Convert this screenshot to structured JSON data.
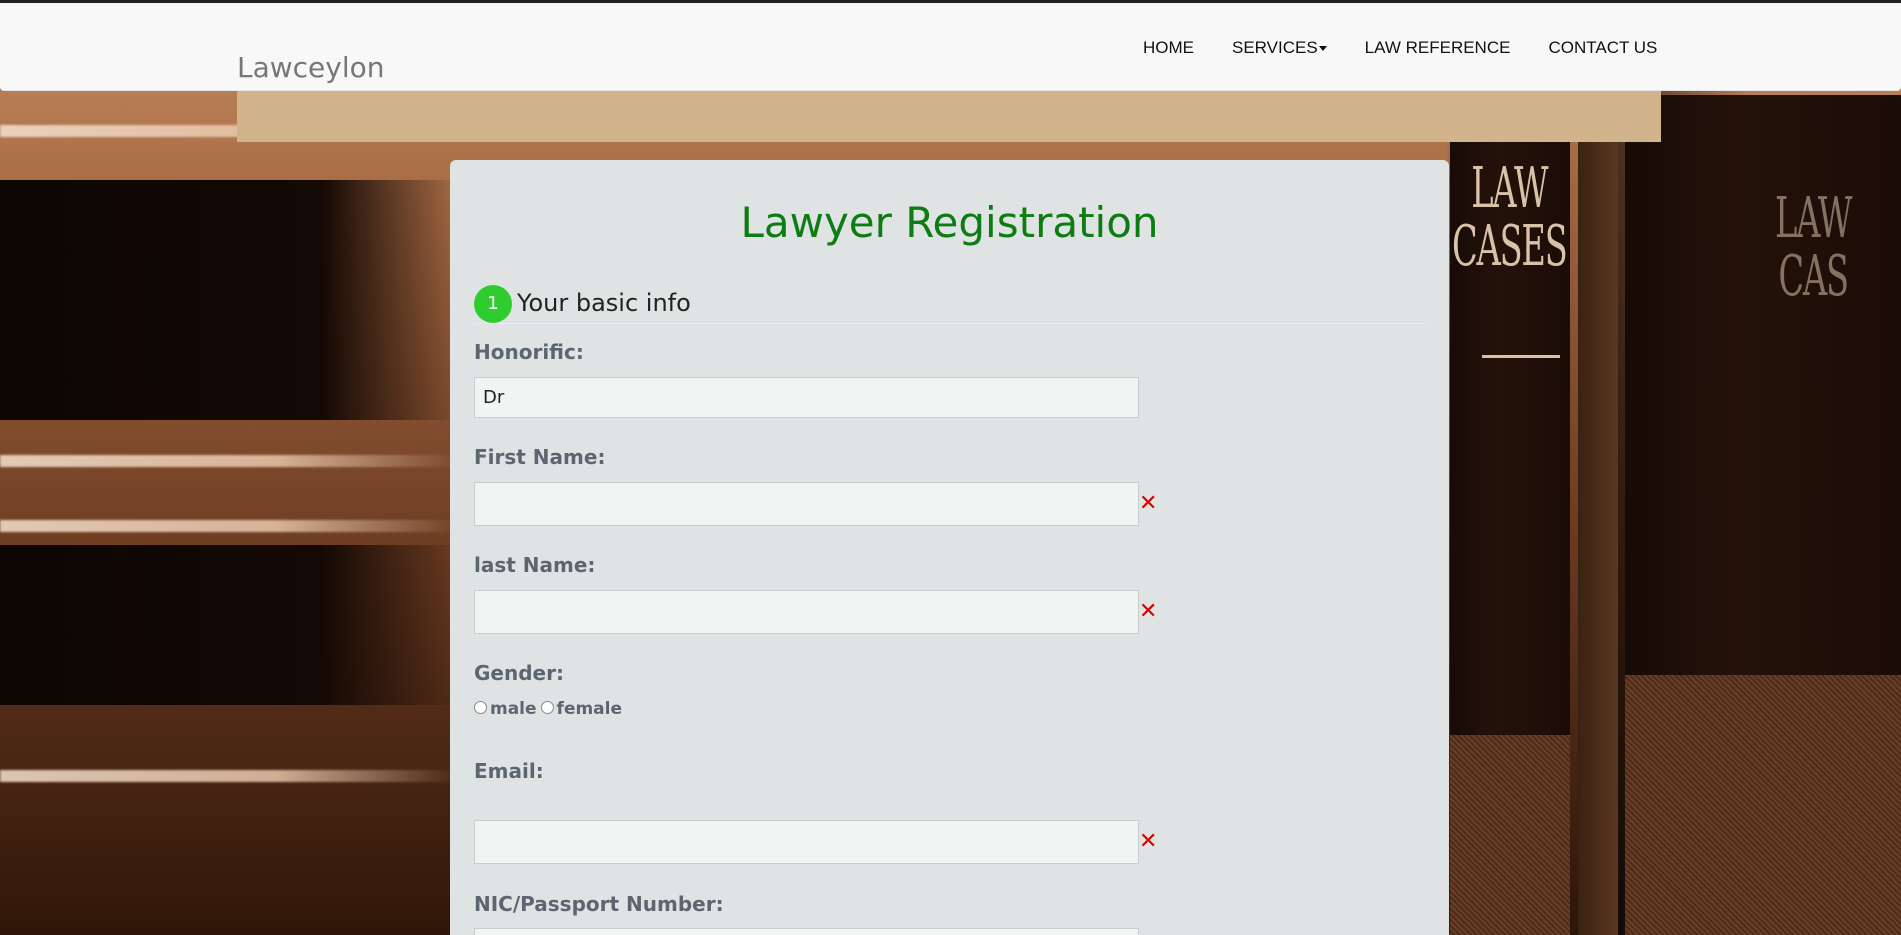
{
  "navbar": {
    "brand": "Lawceylon",
    "items": [
      {
        "label": "HOME"
      },
      {
        "label": "SERVICES",
        "has_dropdown": true
      },
      {
        "label": "LAW REFERENCE"
      },
      {
        "label": "CONTACT US"
      }
    ]
  },
  "form": {
    "title": "Lawyer Registration",
    "section": {
      "step": "1",
      "title": "Your basic info"
    },
    "honorific": {
      "label": "Honorific:",
      "value": "Dr"
    },
    "first_name": {
      "label": "First Name:",
      "value": ""
    },
    "last_name": {
      "label": "last Name:",
      "value": ""
    },
    "gender": {
      "label": "Gender:",
      "options": [
        "male",
        "female"
      ]
    },
    "email": {
      "label": "Email:",
      "value": ""
    },
    "nic": {
      "label": "NIC/Passport Number:"
    },
    "invalid_mark": "✕"
  },
  "background": {
    "book_titles": [
      "LAW\nCASES",
      "LAW\nCAS"
    ]
  },
  "colors": {
    "title_green": "#0d7c12",
    "step_badge": "#2ecc2e",
    "tan_band": "#d2b48c",
    "error_red": "#dd0000"
  }
}
